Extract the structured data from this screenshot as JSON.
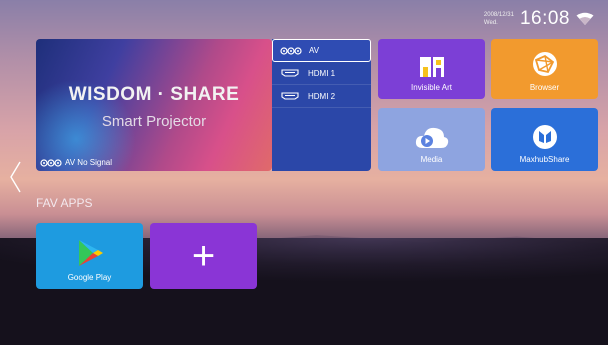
{
  "status": {
    "date": "2008/12/31",
    "weekday": "Wed.",
    "time": "16:08"
  },
  "hero": {
    "title": "WISDOM · SHARE",
    "subtitle": "Smart Projector",
    "signal": "AV No Signal"
  },
  "inputs": [
    {
      "label": "AV",
      "icon": "av-icon",
      "selected": true
    },
    {
      "label": "HDMI 1",
      "icon": "hdmi-icon",
      "selected": false
    },
    {
      "label": "HDMI 2",
      "icon": "hdmi-icon",
      "selected": false
    }
  ],
  "apps": {
    "invisible_art": "Invisible Art",
    "browser": "Browser",
    "media": "Media",
    "maxhubshare": "MaxhubShare"
  },
  "fav": {
    "heading": "FAV APPS",
    "google_play": "Google Play",
    "add": "+"
  },
  "colors": {
    "input_panel": "#2b47a8",
    "art": "#7c3fd6",
    "browser": "#f29a2e",
    "media": "#8ea4e0",
    "share": "#2b6fd9",
    "gplay": "#1e9be0",
    "add": "#8a35d6"
  }
}
